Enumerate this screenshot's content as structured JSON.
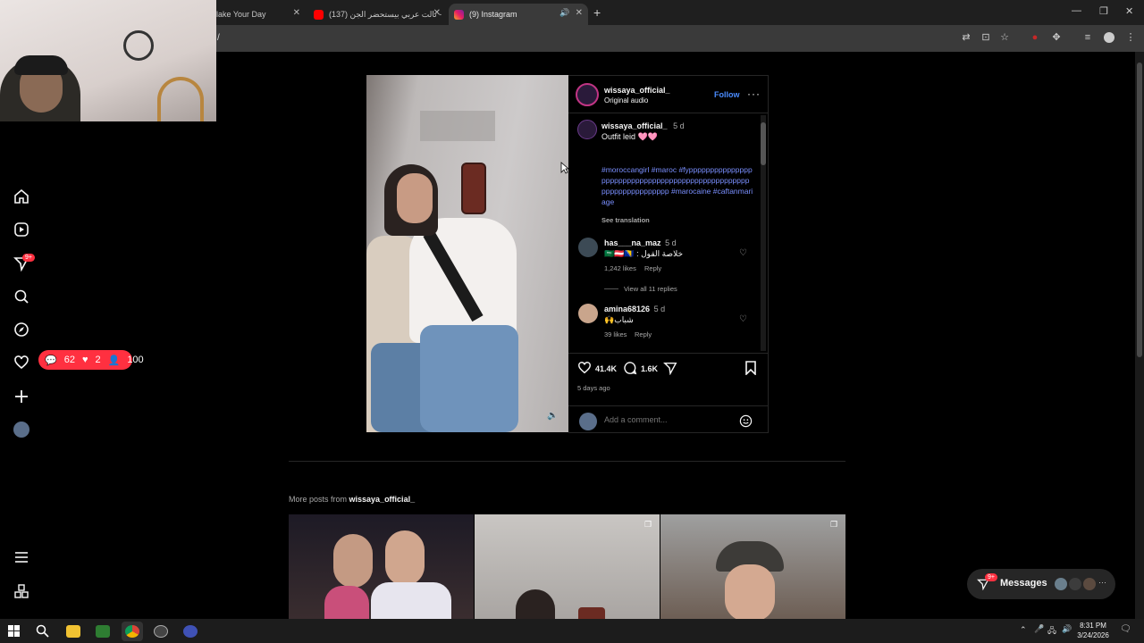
{
  "browser": {
    "tabs": [
      {
        "title": "Make Your Day",
        "shown": "lake Your Day"
      },
      {
        "title": "(137) تالت عربي بيستحضر الجن -"
      },
      {
        "title": "(9) Instagram"
      }
    ],
    "address": "/"
  },
  "sidebar": {
    "notification_badge": "9+",
    "activity": {
      "comments": "62",
      "likes": "2",
      "followers": "100"
    }
  },
  "post": {
    "header": {
      "username": "wissaya_official_",
      "audio": "Original audio",
      "follow": "Follow"
    },
    "caption": {
      "username": "wissaya_official_",
      "age": "5 d",
      "text": "Outfit leid 🩷🩷",
      "hashtags": "#moroccangirl #maroc #fypppppppppppppppppppppppppppppppppppppppppppppppppppppppppppppppppp #marocaine #caftanmariage",
      "see_translation": "See translation"
    },
    "comments": [
      {
        "username": "has___na_maz",
        "age": "5 d",
        "text": "🇸🇦🇦🇹🇧🇦 : خلاصة القول",
        "likes": "1,242 likes",
        "reply": "Reply",
        "view_replies": "View all 11 replies"
      },
      {
        "username": "amina68126",
        "age": "5 d",
        "text": "🙌شباب",
        "likes": "39 likes",
        "reply": "Reply"
      }
    ],
    "likes_count": "41.4K",
    "comments_count": "1.6K",
    "posted": "5 days ago",
    "comment_placeholder": "Add a comment..."
  },
  "more_posts": {
    "prefix": "More posts from ",
    "username": "wissaya_official_"
  },
  "messages": {
    "label": "Messages",
    "badge": "9+"
  },
  "taskbar": {
    "time": "8:31 PM",
    "date": "3/24/2026"
  },
  "colors": {
    "accent": "#4a8cff",
    "badge": "#ff3040",
    "hashtag": "#7a8fff"
  }
}
